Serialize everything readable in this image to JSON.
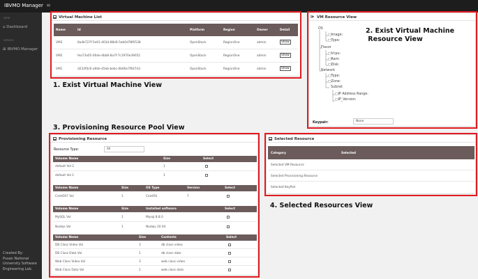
{
  "app": {
    "title": "IBVMO Manager",
    "menu_icon": "≡"
  },
  "sidebar": {
    "section1": "VIEW",
    "item1": "Dashboard",
    "section2": "SERVICE",
    "item2": "IBVMO Manager",
    "footer": "Created By:\nPusan National\nUniversity Software\nEngineering Lab."
  },
  "vm_list": {
    "title": "Virtual Machine List",
    "headers": [
      "Name",
      "Id",
      "Platform",
      "Region",
      "Owner",
      "Detail"
    ],
    "rows": [
      {
        "name": "VM3",
        "id": "8a4b727f-5e61-403d-88e6-5eb0d78f0538",
        "platform": "OpenStack",
        "region": "RegionOne",
        "owner": "admin",
        "detail": "Show"
      },
      {
        "name": "VM2",
        "id": "fea73a05-00de-4bb6-8a7f-7c1970e39052",
        "platform": "OpenStack",
        "region": "RegionOne",
        "owner": "admin",
        "detail": "Show"
      },
      {
        "name": "VM1",
        "id": "d232f0c6-a94e-45eb-bebc-0b66e7f647d3",
        "platform": "OpenStack",
        "region": "RegionOne",
        "owner": "admin",
        "detail": "Show"
      }
    ]
  },
  "resource_view": {
    "title": "VM Resource View",
    "os": "OS",
    "image": "□Image:",
    "type1": "□Type:",
    "flavor": "Flavor",
    "vcpu": "□Vcpu:",
    "ram": "□Ram:",
    "disk": "□Disk:",
    "network": "Network",
    "type2": "□Type:",
    "zone": "□Zone:",
    "subnet": "Subnet",
    "ip_range": "□IP Address Range:",
    "ip_version": "□IP_Version:",
    "keypair_label": "Keypair:",
    "keypair_value": "None"
  },
  "pool": {
    "title": "Provisioning Resource",
    "type_label": "Resource Type:",
    "type_value": "All",
    "volume": {
      "headers": [
        "Volume Name",
        "Size",
        "Select"
      ],
      "rows": [
        {
          "name": "default Vol 2",
          "size": "1"
        },
        {
          "name": "default Vol 1",
          "size": "1"
        }
      ]
    },
    "os": {
      "headers": [
        "Volume Name",
        "Size",
        "OS Type",
        "Version",
        "Select"
      ],
      "rows": [
        {
          "name": "CentOS7 Vol",
          "size": "1",
          "os": "CentOS",
          "ver": "7"
        }
      ]
    },
    "sw": {
      "headers": [
        "Volume Name",
        "Size",
        "Installed software",
        "Select"
      ],
      "rows": [
        {
          "name": "MySQL Vol",
          "size": "1",
          "sw": "Mysql 8.8.0"
        },
        {
          "name": "Nodejs Vol",
          "size": "1",
          "sw": "Nodejs 20.04"
        }
      ]
    },
    "contents": {
      "headers": [
        "Volume Name",
        "Size",
        "Contents",
        "Select"
      ],
      "rows": [
        {
          "name": "DB Class Video Vol",
          "size": "3",
          "c": "db class video"
        },
        {
          "name": "DB Class Data Vol",
          "size": "1",
          "c": "db class date"
        },
        {
          "name": "Web Class Video Vol",
          "size": "3",
          "c": "web class video"
        },
        {
          "name": "Web Class Data Vol",
          "size": "1",
          "c": "web class data"
        }
      ]
    }
  },
  "selected": {
    "title": "Selected Resource",
    "headers": [
      "Category",
      "Selected"
    ],
    "rows": [
      "Selected VM Resource",
      "Selected Provisioning Resource",
      "Selected KeyPair"
    ]
  },
  "captions": {
    "c1": "1. Exist Virtual Machine View",
    "c2": "2. Exist Virtual Machine\n Resource View",
    "c3": "3. Provisioning Resource Pool View",
    "c4": "4. Selected Resources View"
  },
  "colors": {
    "highlight": "#e0191f",
    "table_header": "#6b5b5b"
  }
}
